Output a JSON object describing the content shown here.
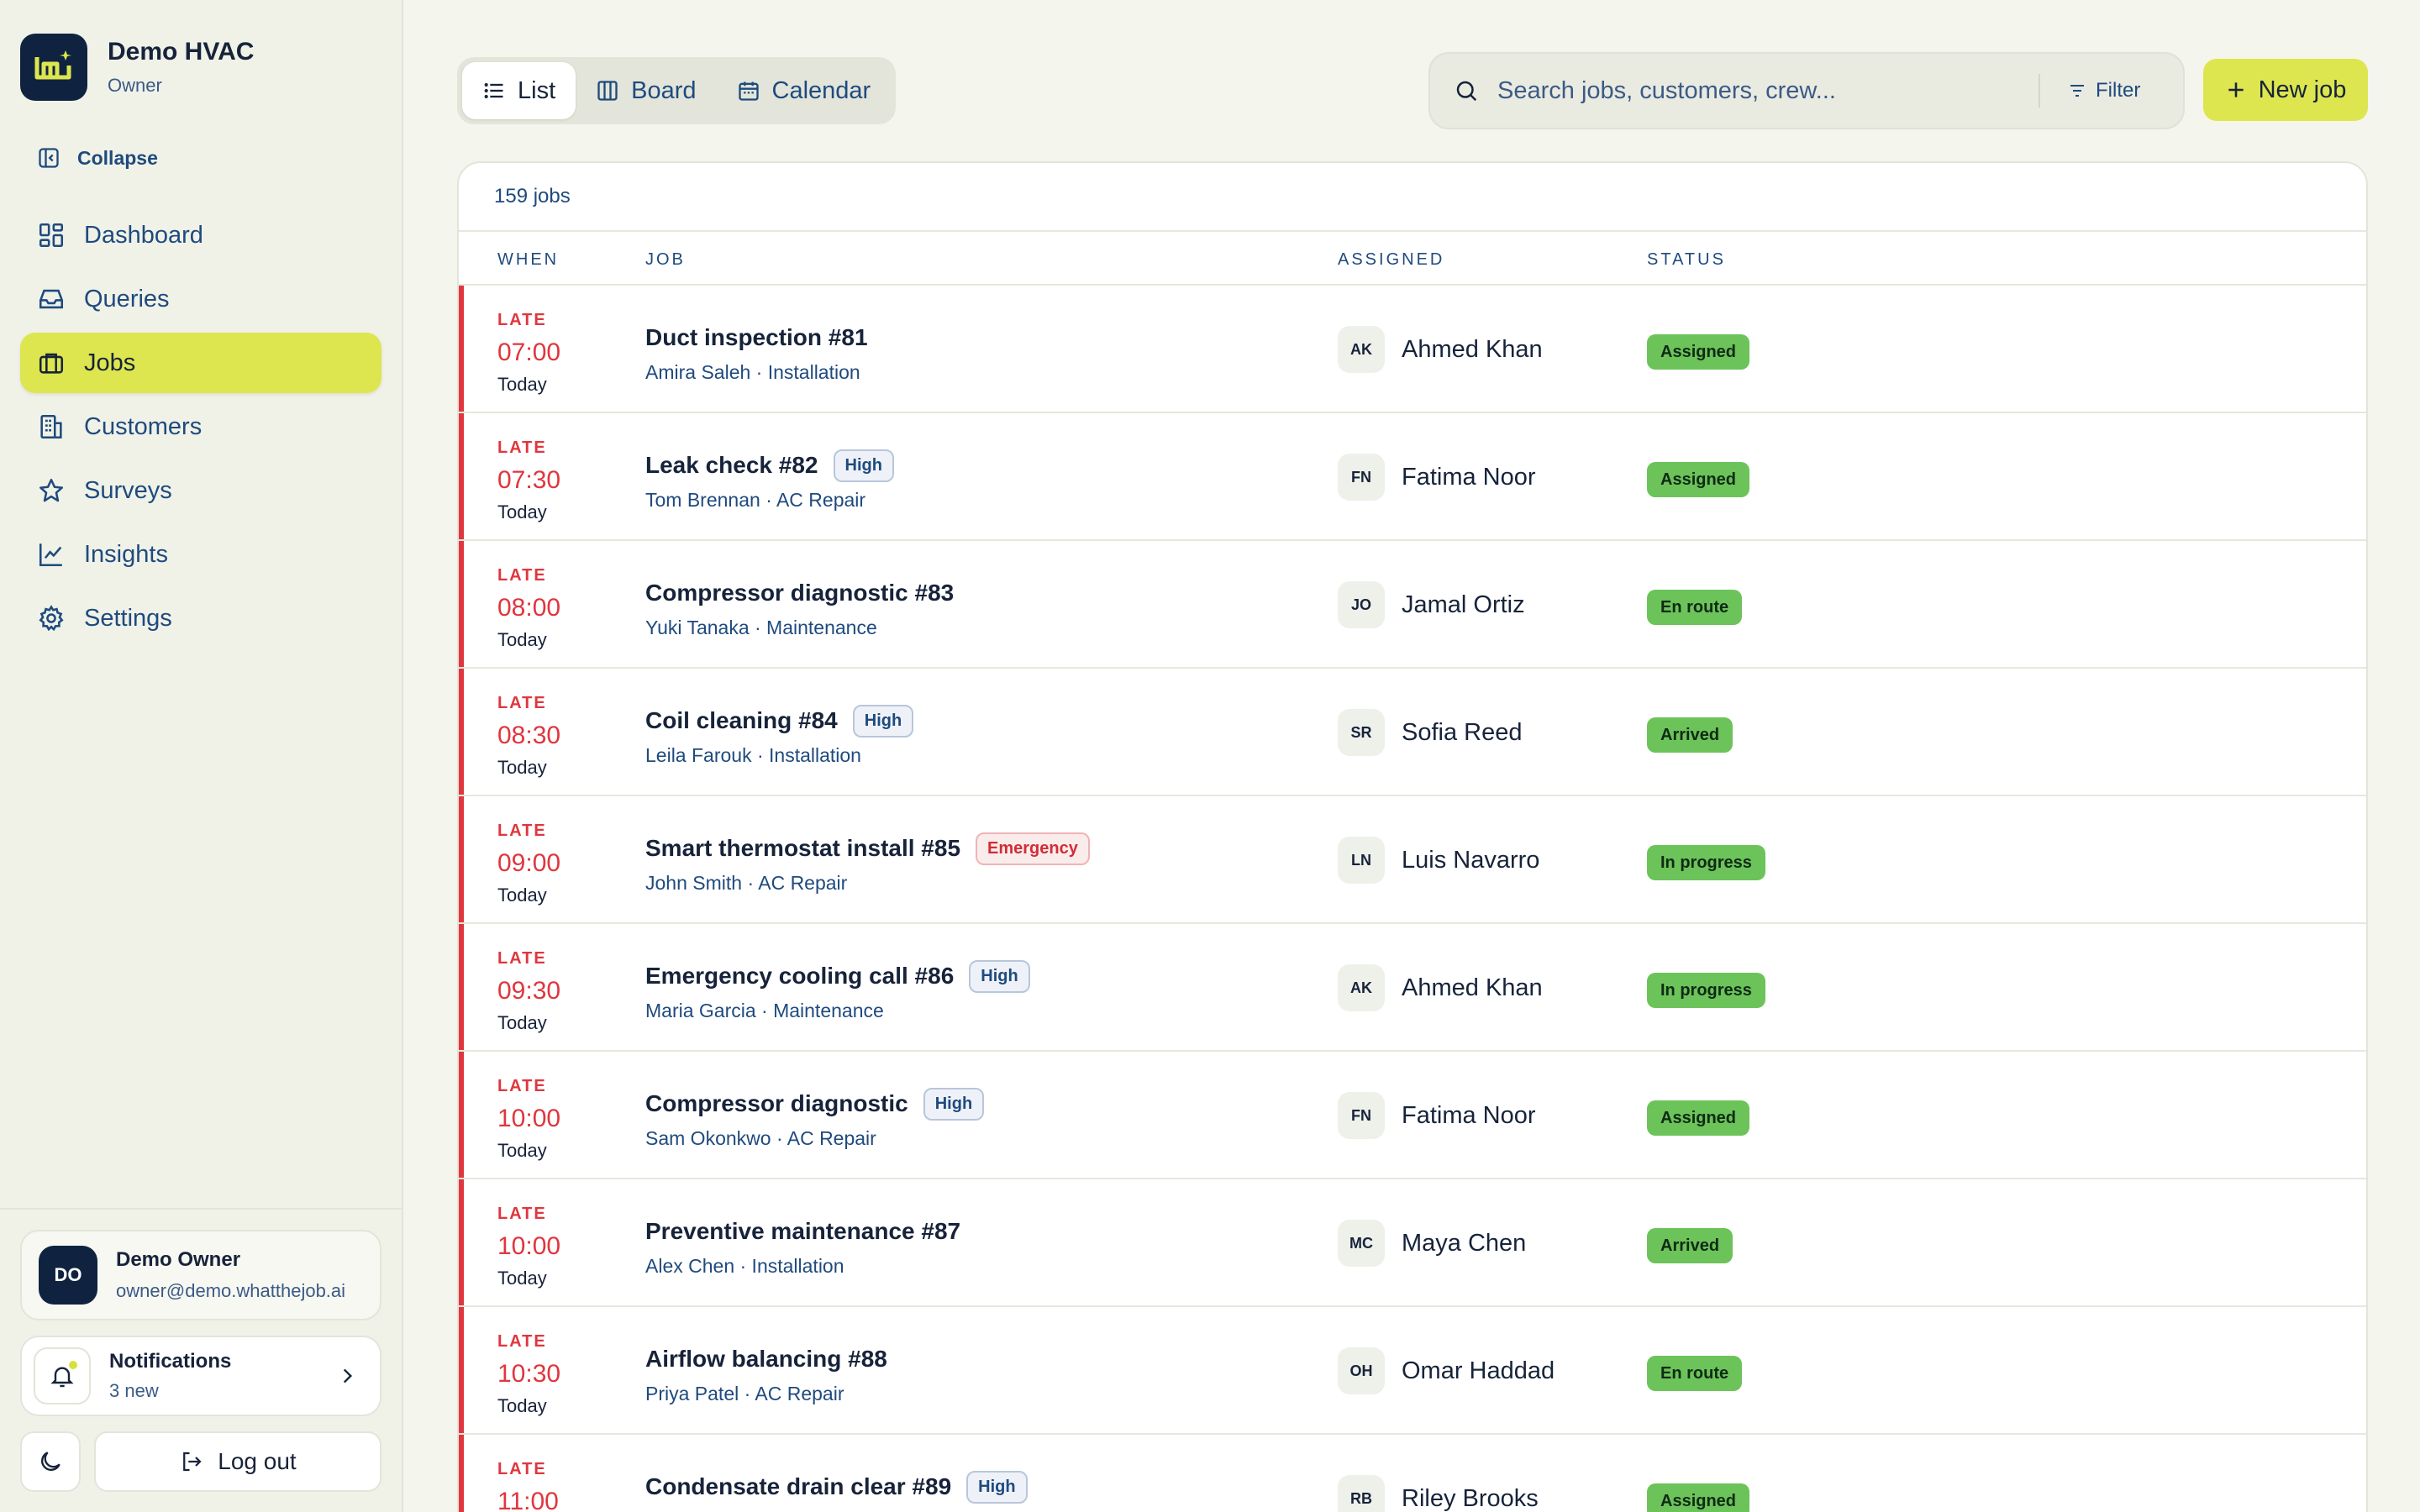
{
  "brand": {
    "name": "Demo HVAC",
    "role": "Owner"
  },
  "sidebar": {
    "collapse_label": "Collapse",
    "items": [
      {
        "label": "Dashboard",
        "icon": "dashboard-icon"
      },
      {
        "label": "Queries",
        "icon": "inbox-icon"
      },
      {
        "label": "Jobs",
        "icon": "briefcase-icon",
        "active": true
      },
      {
        "label": "Customers",
        "icon": "building-icon"
      },
      {
        "label": "Surveys",
        "icon": "star-icon"
      },
      {
        "label": "Insights",
        "icon": "chart-line-icon"
      },
      {
        "label": "Settings",
        "icon": "gear-icon"
      }
    ],
    "user": {
      "initials": "DO",
      "name": "Demo Owner",
      "email": "owner@demo.whatthejob.ai"
    },
    "notifications": {
      "title": "Notifications",
      "sub": "3 new"
    },
    "logout_label": "Log out"
  },
  "toolbar": {
    "views": [
      "List",
      "Board",
      "Calendar"
    ],
    "active_view": "List",
    "search_placeholder": "Search jobs, customers, crew...",
    "filter_label": "Filter",
    "new_job_label": "New job"
  },
  "table": {
    "count": "159 jobs",
    "headers": {
      "when": "WHEN",
      "job": "JOB",
      "assigned": "ASSIGNED",
      "status": "STATUS"
    },
    "rows": [
      {
        "late": "LATE",
        "time": "07:00",
        "day": "Today",
        "title": "Duct inspection #81",
        "badge": "",
        "badge_type": "",
        "sub": "Amira Saleh · Installation",
        "initials": "AK",
        "assignee": "Ahmed Khan",
        "status": "Assigned"
      },
      {
        "late": "LATE",
        "time": "07:30",
        "day": "Today",
        "title": "Leak check #82",
        "badge": "High",
        "badge_type": "high",
        "sub": "Tom Brennan · AC Repair",
        "initials": "FN",
        "assignee": "Fatima Noor",
        "status": "Assigned"
      },
      {
        "late": "LATE",
        "time": "08:00",
        "day": "Today",
        "title": "Compressor diagnostic #83",
        "badge": "",
        "badge_type": "",
        "sub": "Yuki Tanaka · Maintenance",
        "initials": "JO",
        "assignee": "Jamal Ortiz",
        "status": "En route"
      },
      {
        "late": "LATE",
        "time": "08:30",
        "day": "Today",
        "title": "Coil cleaning #84",
        "badge": "High",
        "badge_type": "high",
        "sub": "Leila Farouk · Installation",
        "initials": "SR",
        "assignee": "Sofia Reed",
        "status": "Arrived"
      },
      {
        "late": "LATE",
        "time": "09:00",
        "day": "Today",
        "title": "Smart thermostat install #85",
        "badge": "Emergency",
        "badge_type": "emergency",
        "sub": "John Smith · AC Repair",
        "initials": "LN",
        "assignee": "Luis Navarro",
        "status": "In progress"
      },
      {
        "late": "LATE",
        "time": "09:30",
        "day": "Today",
        "title": "Emergency cooling call #86",
        "badge": "High",
        "badge_type": "high",
        "sub": "Maria Garcia · Maintenance",
        "initials": "AK",
        "assignee": "Ahmed Khan",
        "status": "In progress"
      },
      {
        "late": "LATE",
        "time": "10:00",
        "day": "Today",
        "title": "Compressor diagnostic",
        "badge": "High",
        "badge_type": "high",
        "sub": "Sam Okonkwo · AC Repair",
        "initials": "FN",
        "assignee": "Fatima Noor",
        "status": "Assigned"
      },
      {
        "late": "LATE",
        "time": "10:00",
        "day": "Today",
        "title": "Preventive maintenance #87",
        "badge": "",
        "badge_type": "",
        "sub": "Alex Chen · Installation",
        "initials": "MC",
        "assignee": "Maya Chen",
        "status": "Arrived"
      },
      {
        "late": "LATE",
        "time": "10:30",
        "day": "Today",
        "title": "Airflow balancing #88",
        "badge": "",
        "badge_type": "",
        "sub": "Priya Patel · AC Repair",
        "initials": "OH",
        "assignee": "Omar Haddad",
        "status": "En route"
      },
      {
        "late": "LATE",
        "time": "11:00",
        "day": "Today",
        "title": "Condensate drain clear #89",
        "badge": "High",
        "badge_type": "high",
        "sub": "",
        "initials": "RB",
        "assignee": "Riley Brooks",
        "status": "Assigned"
      }
    ]
  },
  "colors": {
    "accent": "#dde64e",
    "late": "#e0363e",
    "status": "#6cc35a",
    "navy": "#0f2340"
  }
}
